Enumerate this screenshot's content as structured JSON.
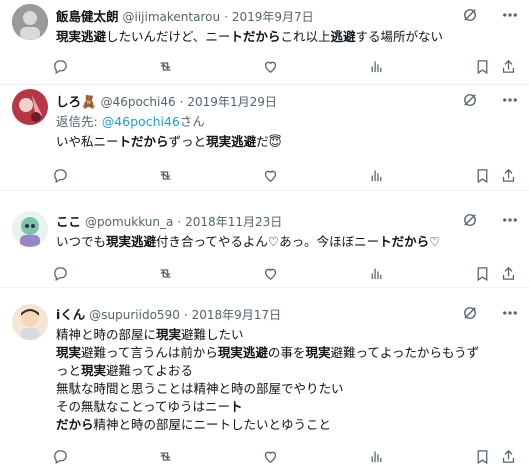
{
  "tweets": [
    {
      "name": "飯島健太朗",
      "handle": "@iijimakentarou",
      "date": "2019年9月7日",
      "line1_a": "現実逃避",
      "line1_b": "したいんだけど、ニー",
      "line1_c": "ト",
      "line1_d": "だから",
      "line1_e": "これ以上",
      "line1_f": "逃避",
      "line1_g": "する場所がない",
      "avatar_color": "#8a8a8a"
    },
    {
      "name": "しろ🧸",
      "handle": "@46pochi46",
      "date": "2019年1月29日",
      "reply_prefix": "返信先:",
      "reply_handle": "@46pochi46",
      "reply_suffix": "さん",
      "line1_a": "いや私ニー",
      "line1_b": "ト",
      "line1_c": "だから",
      "line1_d": "ずっと",
      "line1_e": "現実逃避",
      "line1_f": "だ😇",
      "avatar_color": "#c93a4a"
    },
    {
      "name": "ここ",
      "handle": "@pomukkun_a",
      "date": "2018年11月23日",
      "line1_a": "いつでも",
      "line1_b": "現実逃避",
      "line1_c": "付き合ってやるよん♡あっ。今ほぼニー",
      "line1_d": "ト",
      "line1_e": "だから",
      "line1_f": "♡",
      "avatar_color": "#6fb7a8"
    },
    {
      "name": "iくん",
      "handle": "@supuriido590",
      "date": "2018年9月17日",
      "lines": [
        [
          "精神と時の部屋に",
          "現実",
          "避難したい"
        ],
        [
          "現実",
          "避難って言うんは前から",
          "現実逃避",
          "の事を",
          "現実",
          "避難ってよったからもうず"
        ],
        [
          "っと",
          "現実",
          "避難ってよおる"
        ],
        [
          "無駄な時間と思うことは精神と時の部屋でやりたい"
        ],
        [
          "その無駄なことってゆうはニー",
          "ト"
        ],
        [
          "だから",
          "精神と時の部屋にニートしたいとゆうこと"
        ]
      ],
      "avatar_color": "#e9c9a0"
    }
  ],
  "icons": [
    "reply-icon",
    "retweet-icon",
    "like-icon",
    "views-icon",
    "bookmark-icon",
    "share-icon",
    "grok-icon",
    "more-icon"
  ]
}
